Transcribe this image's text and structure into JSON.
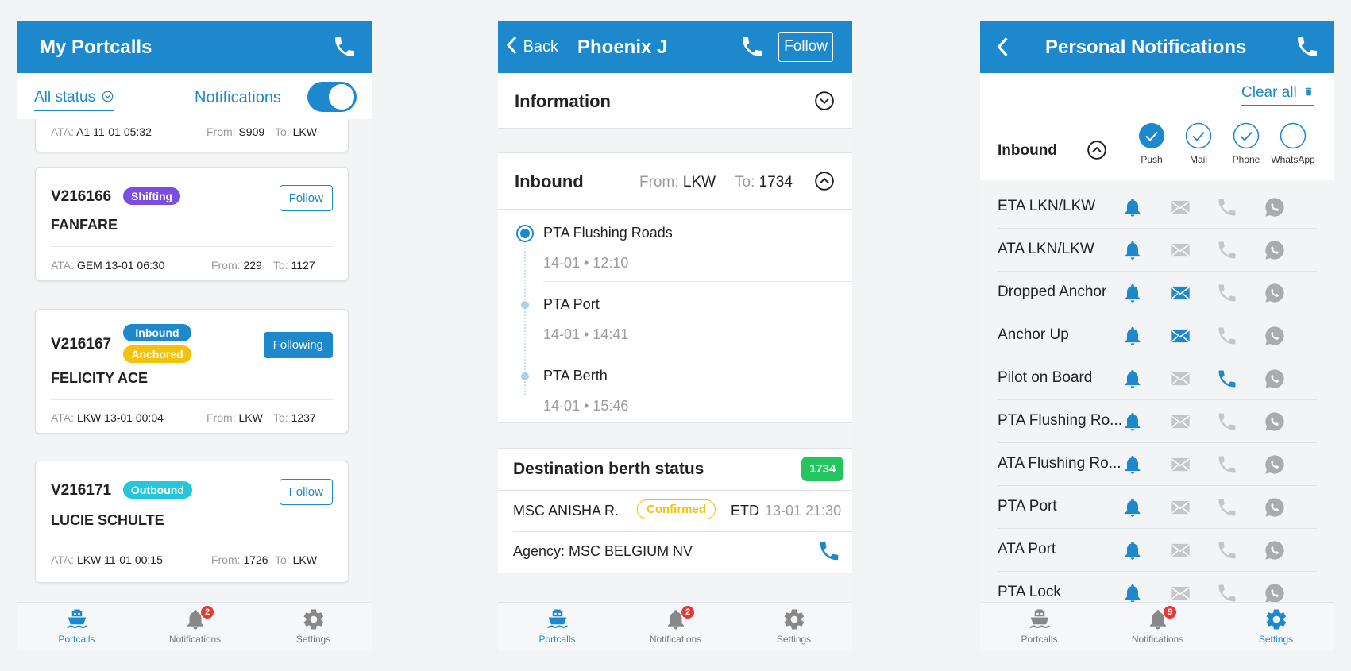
{
  "colors": {
    "primary": "#1d88cb",
    "shifting": "#7b4de3",
    "inbound": "#1d88cb",
    "anchored": "#f4c20d",
    "outbound": "#26c6da",
    "berth": "#22c55e",
    "confirmed": "#f4c20d"
  },
  "screen1": {
    "title": "My Portcalls",
    "filter_label": "All status",
    "notifications_label": "Notifications",
    "partial_row": {
      "ata_label": "ATA:",
      "ata_value": "A1 11-01 05:32",
      "from_label": "From:",
      "from_value": "S909",
      "to_label": "To:",
      "to_value": "LKW"
    },
    "cards": [
      {
        "id": "V216166",
        "name": "FANFARE",
        "tags": [
          "Shifting"
        ],
        "follow": "Follow",
        "ata_label": "ATA:",
        "ata_value": "GEM 13-01 06:30",
        "from_label": "From:",
        "from_value": "229",
        "to_label": "To:",
        "to_value": "1127"
      },
      {
        "id": "V216167",
        "name": "FELICITY ACE",
        "tags": [
          "Inbound",
          "Anchored"
        ],
        "follow": "Following",
        "ata_label": "ATA:",
        "ata_value": "LKW 13-01 00:04",
        "from_label": "From:",
        "from_value": "LKW",
        "to_label": "To:",
        "to_value": "1237"
      },
      {
        "id": "V216171",
        "name": "LUCIE SCHULTE",
        "tags": [
          "Outbound"
        ],
        "follow": "Follow",
        "ata_label": "ATA:",
        "ata_value": "LKW 11-01 00:15",
        "from_label": "From:",
        "from_value": "1726",
        "to_label": "To:",
        "to_value": "LKW"
      }
    ],
    "tabs": {
      "portcalls": "Portcalls",
      "notifications": "Notifications",
      "notifications_badge": "2",
      "settings": "Settings"
    }
  },
  "screen2": {
    "back_label": "Back",
    "title": "Phoenix J",
    "follow_label": "Follow",
    "information_title": "Information",
    "inbound": {
      "title": "Inbound",
      "from_label": "From:",
      "from_value": "LKW",
      "to_label": "To:",
      "to_value": "1734"
    },
    "timeline": [
      {
        "name": "PTA Flushing Roads",
        "time": "14-01 • 12:10"
      },
      {
        "name": "PTA Port",
        "time": "14-01 • 14:41"
      },
      {
        "name": "PTA Berth",
        "time": "14-01 • 15:46"
      }
    ],
    "berth": {
      "title": "Destination berth status",
      "badge": "1734",
      "vessel": "MSC ANISHA R.",
      "status": "Confirmed",
      "etd_label": "ETD",
      "etd_value": "13-01 21:30",
      "agency": "Agency: MSC BELGIUM NV"
    },
    "tabs": {
      "portcalls": "Portcalls",
      "notifications": "Notifications",
      "notifications_badge": "2",
      "settings": "Settings"
    }
  },
  "screen3": {
    "title": "Personal Notifications",
    "clear_all": "Clear all",
    "section": "Inbound",
    "channels": [
      "Push",
      "Mail",
      "Phone",
      "WhatsApp"
    ],
    "channel_selected": [
      true,
      true,
      true,
      false
    ],
    "rows": [
      {
        "label": "ETA LKN/LKW",
        "push": true,
        "mail": false,
        "phone": false,
        "whatsapp": false
      },
      {
        "label": "ATA LKN/LKW",
        "push": true,
        "mail": false,
        "phone": false,
        "whatsapp": false
      },
      {
        "label": "Dropped Anchor",
        "push": true,
        "mail": true,
        "phone": false,
        "whatsapp": false
      },
      {
        "label": "Anchor Up",
        "push": true,
        "mail": true,
        "phone": false,
        "whatsapp": false
      },
      {
        "label": "Pilot on Board",
        "push": true,
        "mail": false,
        "phone": true,
        "whatsapp": false
      },
      {
        "label": "PTA Flushing Ro...",
        "push": true,
        "mail": false,
        "phone": false,
        "whatsapp": false
      },
      {
        "label": "ATA Flushing Ro...",
        "push": true,
        "mail": false,
        "phone": false,
        "whatsapp": false
      },
      {
        "label": "PTA Port",
        "push": true,
        "mail": false,
        "phone": false,
        "whatsapp": false
      },
      {
        "label": "ATA Port",
        "push": true,
        "mail": false,
        "phone": false,
        "whatsapp": false
      },
      {
        "label": "PTA Lock",
        "push": true,
        "mail": false,
        "phone": false,
        "whatsapp": false
      }
    ],
    "tabs": {
      "portcalls": "Portcalls",
      "notifications": "Notifications",
      "notifications_badge": "9",
      "settings": "Settings"
    }
  }
}
